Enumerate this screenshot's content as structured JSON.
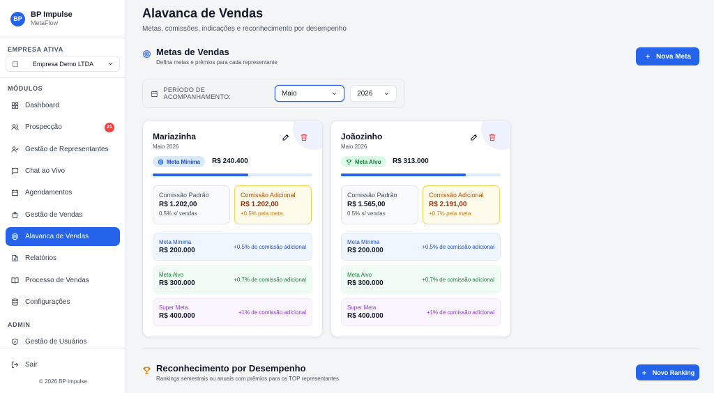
{
  "brand": {
    "logo": "BP",
    "name": "BP Impulse",
    "sub": "MetaFlow"
  },
  "company": {
    "label": "EMPRESA ATIVA",
    "selected": "Empresa Demo LTDA",
    "icon": "building-icon"
  },
  "modules_label": "MÓDULOS",
  "admin_label": "ADMIN",
  "nav": [
    {
      "label": "Dashboard",
      "icon": "dashboard-icon"
    },
    {
      "label": "Prospecção",
      "icon": "users-icon",
      "badge": "21"
    },
    {
      "label": "Gestão de Representantes",
      "icon": "user-check-icon"
    },
    {
      "label": "Chat ao Vivo",
      "icon": "chat-icon"
    },
    {
      "label": "Agendamentos",
      "icon": "calendar-icon"
    },
    {
      "label": "Gestão de Vendas",
      "icon": "shopping-bag-icon"
    },
    {
      "label": "Alavanca de Vendas",
      "icon": "target-icon",
      "active": true
    },
    {
      "label": "Relatórios",
      "icon": "report-icon"
    },
    {
      "label": "Processo de Vendas",
      "icon": "book-icon"
    },
    {
      "label": "Configurações",
      "icon": "database-icon"
    }
  ],
  "admin_nav": [
    {
      "label": "Gestão de Usuários",
      "icon": "shield-icon"
    }
  ],
  "logout": "Sair",
  "copyright": "© 2026 BP Impulse",
  "page": {
    "title": "Alavanca de Vendas",
    "subtitle": "Metas, comissões, indicações e reconhecimento por desempenho"
  },
  "goals": {
    "title": "Metas de Vendas",
    "subtitle": "Defina metas e prêmios para cada representante",
    "new_button": "Nova Meta"
  },
  "period": {
    "label": "PERÍODO DE ACOMPANHAMENTO:",
    "month": "Maio",
    "year": "2026"
  },
  "cards": [
    {
      "name": "Mariazinha",
      "period": "Maio 2026",
      "tier": "Meta Mínima",
      "tier_icon": "target-icon",
      "tier_color": "#dbeafe",
      "tier_text": "#1d4ed8",
      "value": "R$ 240.400",
      "progress": 0.6,
      "std": {
        "label": "Comissão Padrão",
        "value": "R$ 1.202,00",
        "note": "0.5% s/ vendas"
      },
      "add": {
        "label": "Comissão Adicional",
        "value": "R$ 1.202,00",
        "note": "+0.5% pela meta"
      }
    },
    {
      "name": "Joãozinho",
      "period": "Maio 2026",
      "tier": "Meta Alvo",
      "tier_icon": "trophy-icon",
      "tier_color": "#dcfce7",
      "tier_text": "#15803d",
      "value": "R$ 313.000",
      "progress": 0.78,
      "std": {
        "label": "Comissão Padrão",
        "value": "R$ 1.565,00",
        "note": "0.5% s/ vendas"
      },
      "add": {
        "label": "Comissão Adicional",
        "value": "R$ 2.191,00",
        "note": "+0.7% pela meta"
      }
    }
  ],
  "tiers": [
    {
      "name": "Meta Mínima",
      "amount": "R$ 200.000",
      "bonus": "+0,5% de comissão adicional"
    },
    {
      "name": "Meta Alvo",
      "amount": "R$ 300.000",
      "bonus": "+0,7% de comissão adicional"
    },
    {
      "name": "Super Meta",
      "amount": "R$ 400.000",
      "bonus": "+1% de comissão adicional"
    }
  ],
  "recognition": {
    "title": "Reconhecimento por Desempenho",
    "subtitle": "Rankings semestrais ou anuais com prêmios para os TOP representantes",
    "new_button": "Novo Ranking"
  },
  "colors": {
    "primary": "#2563eb",
    "danger": "#ef4444"
  }
}
